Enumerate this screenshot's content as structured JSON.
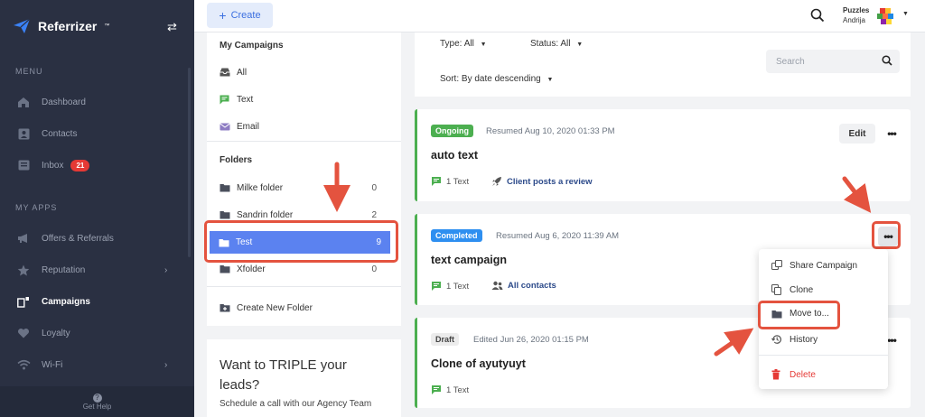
{
  "sidebar": {
    "brand": "Referrizer",
    "brand_tm": "™",
    "sections": {
      "menu": "MENU",
      "apps": "MY APPS"
    },
    "menu_items": [
      {
        "label": "Dashboard",
        "icon": "home-icon"
      },
      {
        "label": "Contacts",
        "icon": "contact-card-icon"
      },
      {
        "label": "Inbox",
        "icon": "inbox-icon",
        "badge": "21"
      }
    ],
    "app_items": [
      {
        "label": "Offers & Referrals",
        "icon": "megaphone-icon"
      },
      {
        "label": "Reputation",
        "icon": "star-icon"
      },
      {
        "label": "Campaigns",
        "icon": "campaigns-icon",
        "active": true
      },
      {
        "label": "Loyalty",
        "icon": "heart-icon"
      },
      {
        "label": "Wi-Fi",
        "icon": "wifi-icon"
      }
    ],
    "get_help": "Get Help"
  },
  "topbar": {
    "create_label": "Create",
    "org_name": "Puzzles",
    "user_name": "Andrija"
  },
  "folders_panel": {
    "my_campaigns_title": "My Campaigns",
    "campaign_types": [
      {
        "label": "All",
        "icon": "inbox-tray-icon"
      },
      {
        "label": "Text",
        "icon": "chat-icon"
      },
      {
        "label": "Email",
        "icon": "envelope-icon"
      }
    ],
    "folders_title": "Folders",
    "folders": [
      {
        "label": "Milke folder",
        "count": "0"
      },
      {
        "label": "Sandrin folder",
        "count": "2"
      },
      {
        "label": "Test",
        "count": "9",
        "selected": true
      },
      {
        "label": "Xfolder",
        "count": "0"
      }
    ],
    "create_folder": "Create New Folder"
  },
  "promo": {
    "title": "Want to TRIPLE your leads?",
    "body": "Schedule a call with our Agency Team"
  },
  "filters": {
    "type_label": "Type:",
    "type_value": "All",
    "status_label": "Status:",
    "status_value": "All",
    "sort_label": "Sort:",
    "sort_value": "By date descending",
    "search_placeholder": "Search"
  },
  "campaigns": [
    {
      "status": "Ongoing",
      "meta": "Resumed Aug 10, 2020 01:33 PM",
      "title": "auto text",
      "channel": "1 Text",
      "target": "Client posts a review",
      "edit": "Edit"
    },
    {
      "status": "Completed",
      "meta": "Resumed Aug 6, 2020 11:39 AM",
      "title": "text campaign",
      "channel": "1 Text",
      "target": "All contacts"
    },
    {
      "status": "Draft",
      "meta": "Edited Jun 26, 2020 01:15 PM",
      "title": "Clone of ayutyuyt",
      "channel": "1 Text"
    }
  ],
  "context_menu": {
    "items": [
      {
        "label": "Share Campaign",
        "icon": "share-icon"
      },
      {
        "label": "Clone",
        "icon": "copy-icon"
      },
      {
        "label": "Move to...",
        "icon": "folder-icon"
      },
      {
        "label": "History",
        "icon": "history-icon"
      },
      {
        "label": "Delete",
        "icon": "trash-icon"
      }
    ]
  },
  "colors": {
    "sidebar_bg": "#2a3042",
    "accent_blue": "#5b82f0",
    "ongoing_green": "#4caf50",
    "completed_blue": "#2e8ff0",
    "annotation_red": "#e4533f",
    "delete_red": "#e53935"
  }
}
